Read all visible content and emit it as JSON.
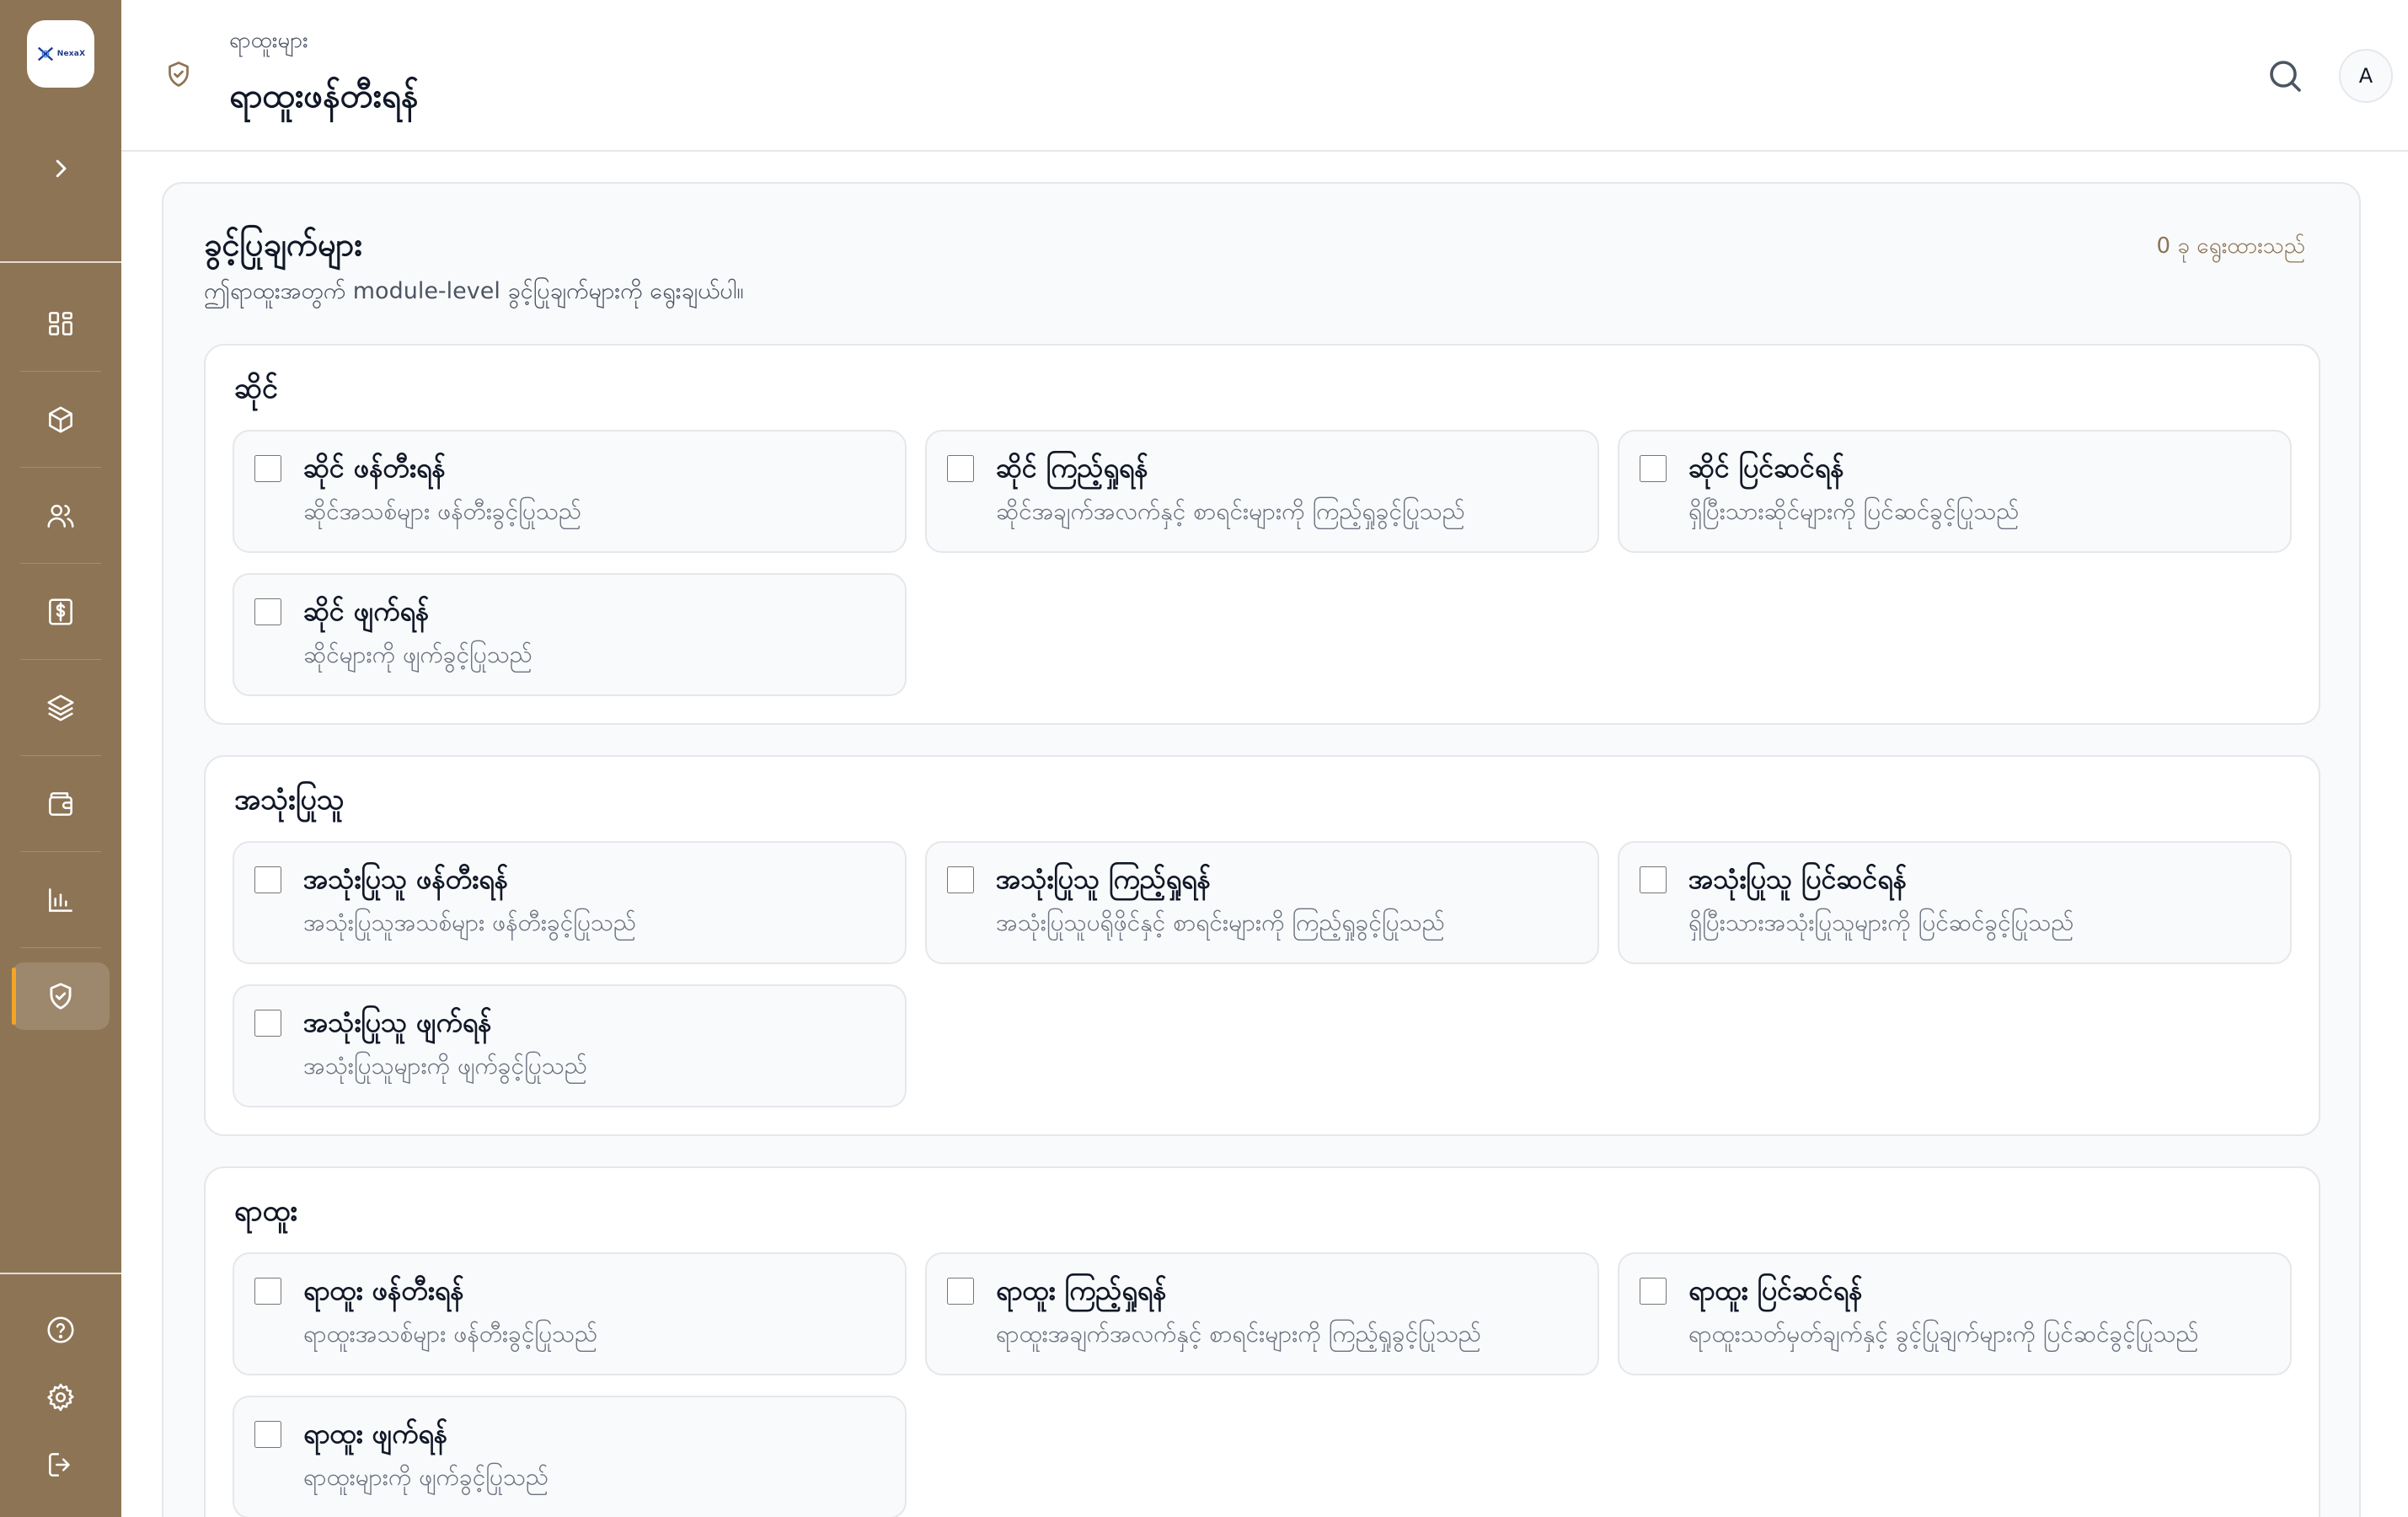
{
  "sidebar": {
    "logo_text": "NexaX",
    "items": [
      {
        "name": "dashboard",
        "icon": "grid-icon"
      },
      {
        "name": "products",
        "icon": "box-icon"
      },
      {
        "name": "users",
        "icon": "users-icon"
      },
      {
        "name": "finance",
        "icon": "dollar-icon"
      },
      {
        "name": "layers",
        "icon": "layers-icon"
      },
      {
        "name": "wallet",
        "icon": "wallet-icon"
      },
      {
        "name": "reports",
        "icon": "bar-chart-icon"
      },
      {
        "name": "roles",
        "icon": "shield-check-icon",
        "active": true
      }
    ],
    "bottom": [
      "help-icon",
      "gear-icon",
      "logout-icon"
    ]
  },
  "header": {
    "breadcrumb": "ရာထူးများ",
    "title": "ရာထူးဖန်တီးရန်",
    "avatar_letter": "A"
  },
  "permissions": {
    "title": "ခွင့်ပြုချက်များ",
    "description": "ဤရာထူးအတွက် module-level ခွင့်ပြုချက်များကို ရွေးချယ်ပါ။",
    "selected_count": "0 ခု ရွေးထားသည်",
    "sections": [
      {
        "title": "ဆိုင်",
        "items": [
          {
            "title": "ဆိုင် ဖန်တီးရန်",
            "desc": "ဆိုင်အသစ်များ ဖန်တီးခွင့်ပြုသည်",
            "checked": false
          },
          {
            "title": "ဆိုင် ကြည့်ရှုရန်",
            "desc": "ဆိုင်အချက်အလက်နှင့် စာရင်းများကို ကြည့်ရှုခွင့်ပြုသည်",
            "checked": false
          },
          {
            "title": "ဆိုင် ပြင်ဆင်ရန်",
            "desc": "ရှိပြီးသားဆိုင်များကို ပြင်ဆင်ခွင့်ပြုသည်",
            "checked": false
          },
          {
            "title": "ဆိုင် ဖျက်ရန်",
            "desc": "ဆိုင်များကို ဖျက်ခွင့်ပြုသည်",
            "checked": false
          }
        ]
      },
      {
        "title": "အသုံးပြုသူ",
        "items": [
          {
            "title": "အသုံးပြုသူ ဖန်တီးရန်",
            "desc": "အသုံးပြုသူအသစ်များ ဖန်တီးခွင့်ပြုသည်",
            "checked": false
          },
          {
            "title": "အသုံးပြုသူ ကြည့်ရှုရန်",
            "desc": "အသုံးပြုသူပရိုဖိုင်နှင့် စာရင်းများကို ကြည့်ရှုခွင့်ပြုသည်",
            "checked": false
          },
          {
            "title": "အသုံးပြုသူ ပြင်ဆင်ရန်",
            "desc": "ရှိပြီးသားအသုံးပြုသူများကို ပြင်ဆင်ခွင့်ပြုသည်",
            "checked": false
          },
          {
            "title": "အသုံးပြုသူ ဖျက်ရန်",
            "desc": "အသုံးပြုသူများကို ဖျက်ခွင့်ပြုသည်",
            "checked": false
          }
        ]
      },
      {
        "title": "ရာထူး",
        "items": [
          {
            "title": "ရာထူး ဖန်တီးရန်",
            "desc": "ရာထူးအသစ်များ ဖန်တီးခွင့်ပြုသည်",
            "checked": false
          },
          {
            "title": "ရာထူး ကြည့်ရှုရန်",
            "desc": "ရာထူးအချက်အလက်နှင့် စာရင်းများကို ကြည့်ရှုခွင့်ပြုသည်",
            "checked": false
          },
          {
            "title": "ရာထူး ပြင်ဆင်ရန်",
            "desc": "ရာထူးသတ်မှတ်ချက်နှင့် ခွင့်ပြုချက်များကို ပြင်ဆင်ခွင့်ပြုသည်",
            "checked": false
          },
          {
            "title": "ရာထူး ဖျက်ရန်",
            "desc": "ရာထူးများကို ဖျက်ခွင့်ပြုသည်",
            "checked": false
          }
        ]
      }
    ]
  },
  "colors": {
    "sidebar": "#8d7455",
    "accent": "#f5a524"
  }
}
